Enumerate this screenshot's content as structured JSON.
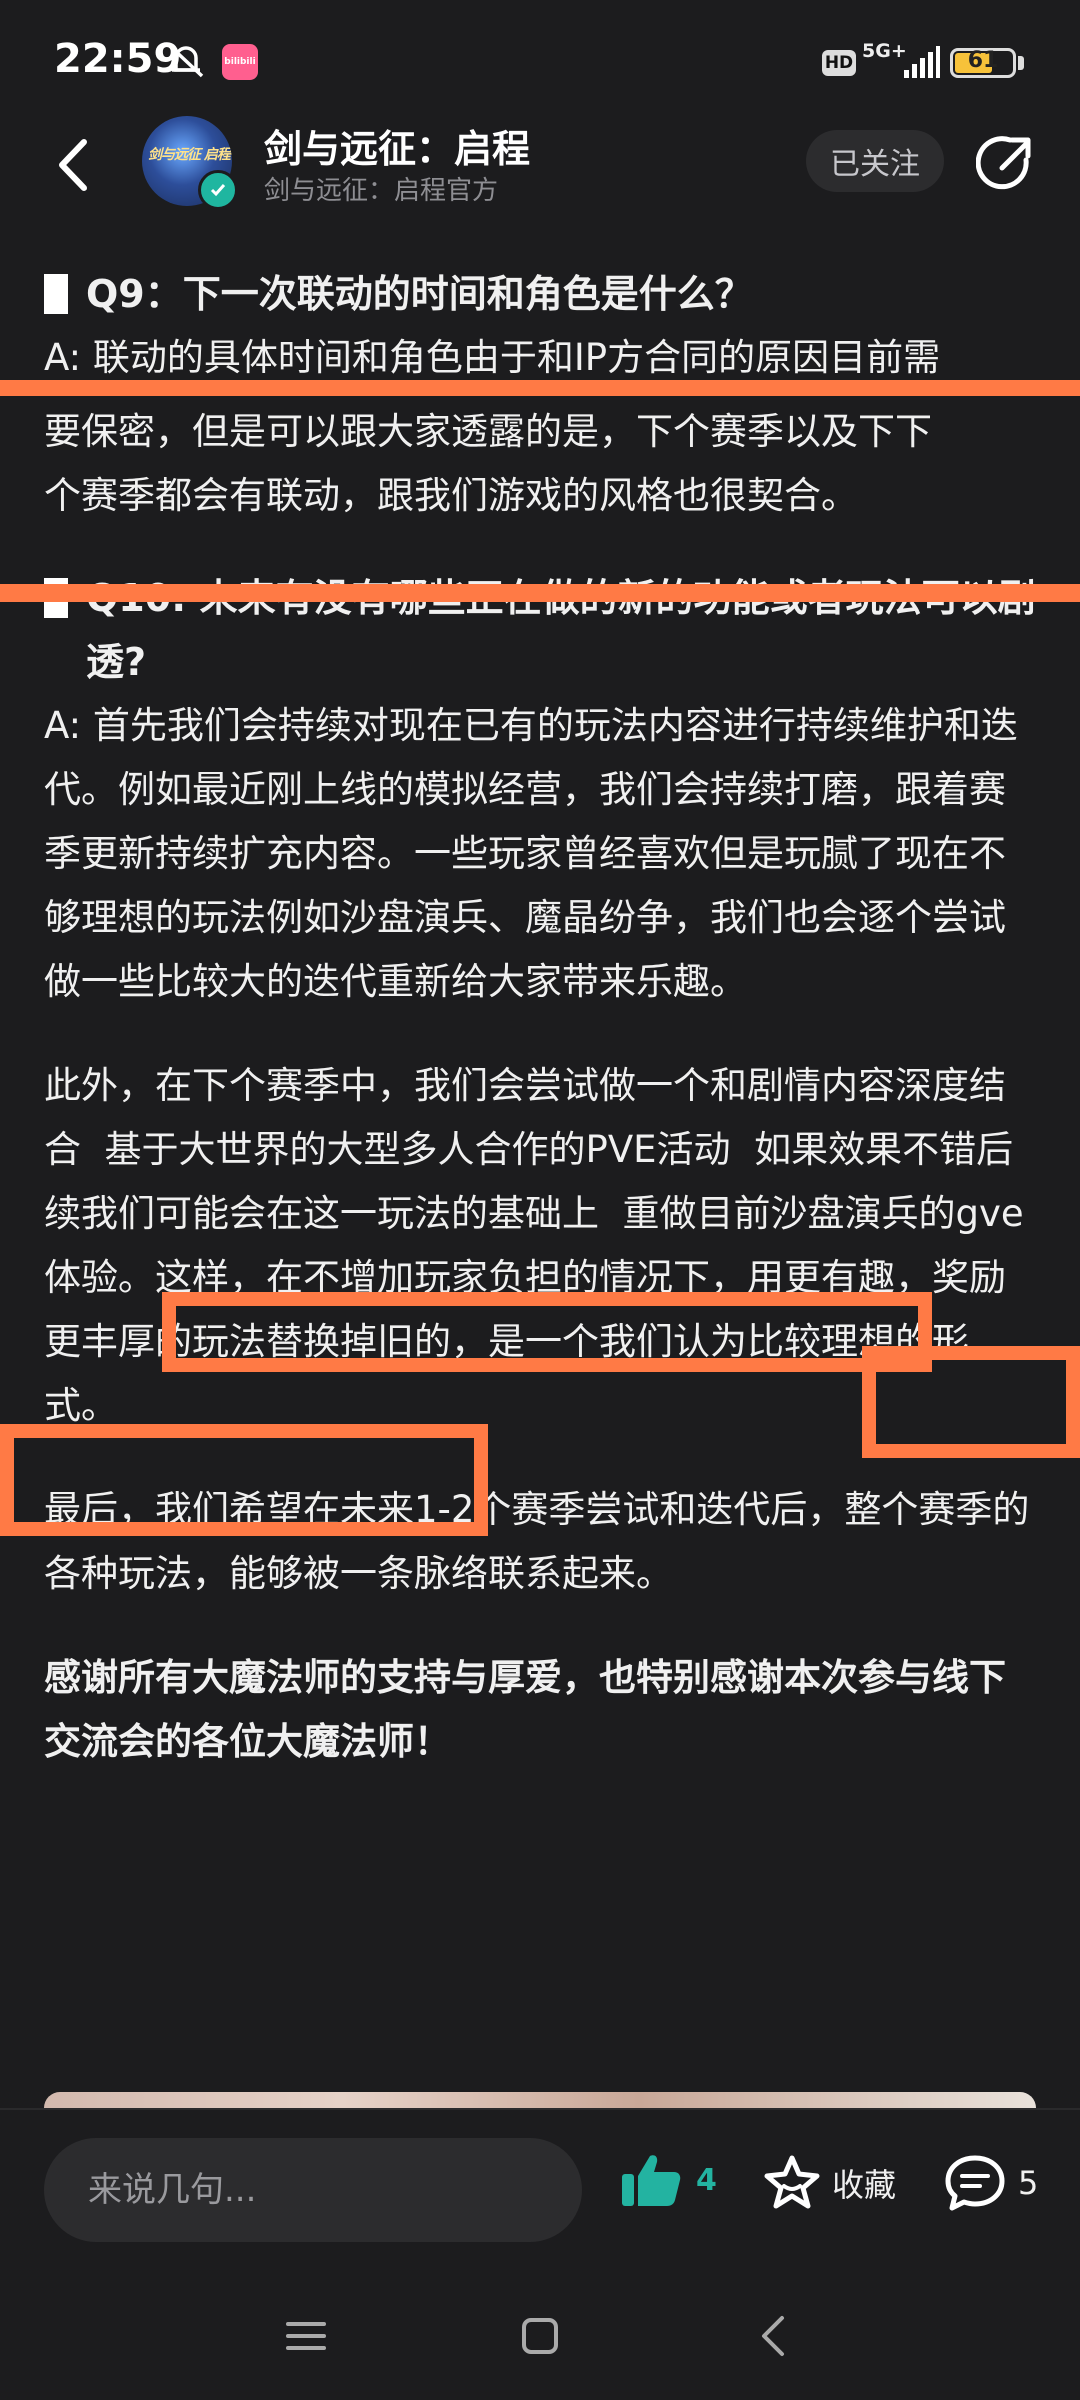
{
  "status_bar": {
    "time": "22:59",
    "app_badge": "bilibili",
    "hd": "HD",
    "network": "5G+",
    "battery": "61"
  },
  "header": {
    "title": "剑与远征：启程",
    "subtitle": "剑与远征：启程官方",
    "follow_label": "已关注",
    "avatar_text": "剑与远征 启程"
  },
  "article": {
    "q9_title": "Q9：下一次联动的时间和角色是什么？",
    "q9_answer_line1": "A: 联动的具体时间和角色由于和IP方合同的原因目前需",
    "q9_answer_line2": "要保密，但是可以跟大家透露的是，下个赛季以及下下",
    "q9_answer_line3": "个赛季都会有联动，跟我们游戏的风格也很契合。",
    "q10_title": "Q10: 未来有没有哪些正在做的新的功能或者玩法可以剧透?",
    "q10_answer": "A: 首先我们会持续对现在已有的玩法内容进行持续维护和迭代。例如最近刚上线的模拟经营，我们会持续打磨，跟着赛季更新持续扩充内容。一些玩家曾经喜欢但是玩腻了现在不够理想的玩法例如沙盘演兵、魔晶纷争，我们也会逐个尝试做一些比较大的迭代重新给大家带来乐趣。",
    "para2_part1": "此外，在下个赛季中，我们会尝试做一个和剧情内容深度结合",
    "para2_highlight1": "基于大世界的大型多人合作的PVE活动",
    "para2_part2": "如果效果不错后续我们可能会在这一玩法的基础上",
    "para2_highlight2": "重做目前沙盘演兵的gve体验。",
    "para2_part3": "这样，在不增加玩家负担的情况下，用更有趣，奖励更丰厚的玩法替换掉旧的，是一个我们认为比较理想的形式。",
    "para3": "最后，我们希望在未来1-2个赛季尝试和迭代后，整个赛季的各种玩法，能够被一条脉络联系起来。",
    "para4": "感谢所有大魔法师的支持与厚爱，也特别感谢本次参与线下交流会的各位大魔法师！"
  },
  "action_bar": {
    "comment_placeholder": "来说几句...",
    "like_count": "4",
    "favorite_label": "收藏",
    "comment_count": "5"
  },
  "colors": {
    "background": "#1c1c1e",
    "annotation": "#ff7a45",
    "like_accent": "#23b3a1"
  }
}
